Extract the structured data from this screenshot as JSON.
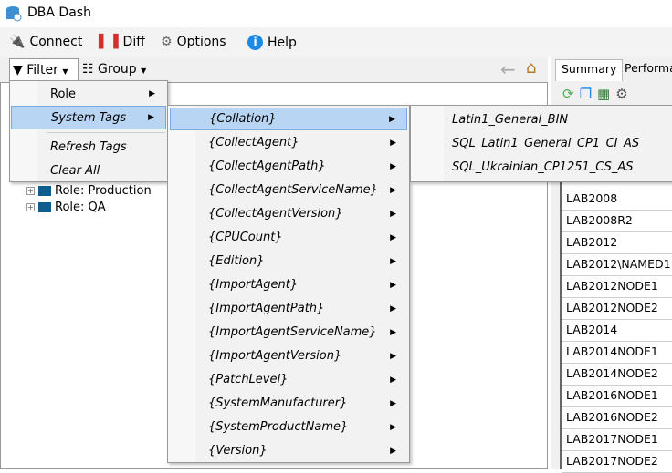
{
  "app": {
    "title": "DBA Dash"
  },
  "menubar": {
    "connect": "Connect",
    "diff": "Diff",
    "options": "Options",
    "help": "Help"
  },
  "toolbar": {
    "filter": "Filter",
    "group": "Group"
  },
  "tabs": [
    "Summary",
    "Performa"
  ],
  "tree": [
    "Role: Production",
    "Role: QA"
  ],
  "filter_menu": {
    "role": "Role",
    "system_tags": "System Tags",
    "refresh_tags": "Refresh Tags",
    "clear_all": "Clear All"
  },
  "system_tags": [
    "{Collation}",
    "{CollectAgent}",
    "{CollectAgentPath}",
    "{CollectAgentServiceName}",
    "{CollectAgentVersion}",
    "{CPUCount}",
    "{Edition}",
    "{ImportAgent}",
    "{ImportAgentPath}",
    "{ImportAgentServiceName}",
    "{ImportAgentVersion}",
    "{PatchLevel}",
    "{SystemManufacturer}",
    "{SystemProductName}",
    "{Version}"
  ],
  "collation_values": [
    "Latin1_General_BIN",
    "SQL_Latin1_General_CP1_CI_AS",
    "SQL_Ukrainian_CP1251_CS_AS"
  ],
  "grid_rows": [
    "LAB2008",
    "LAB2008R2",
    "LAB2012",
    "LAB2012\\NAMED1",
    "LAB2012NODE1",
    "LAB2012NODE2",
    "LAB2014",
    "LAB2014NODE1",
    "LAB2014NODE2",
    "LAB2016NODE1",
    "LAB2016NODE2",
    "LAB2017NODE1",
    "LAB2017NODE2"
  ],
  "colors": {
    "highlight": "#b8d6f3",
    "accent": "#1e88e5"
  }
}
